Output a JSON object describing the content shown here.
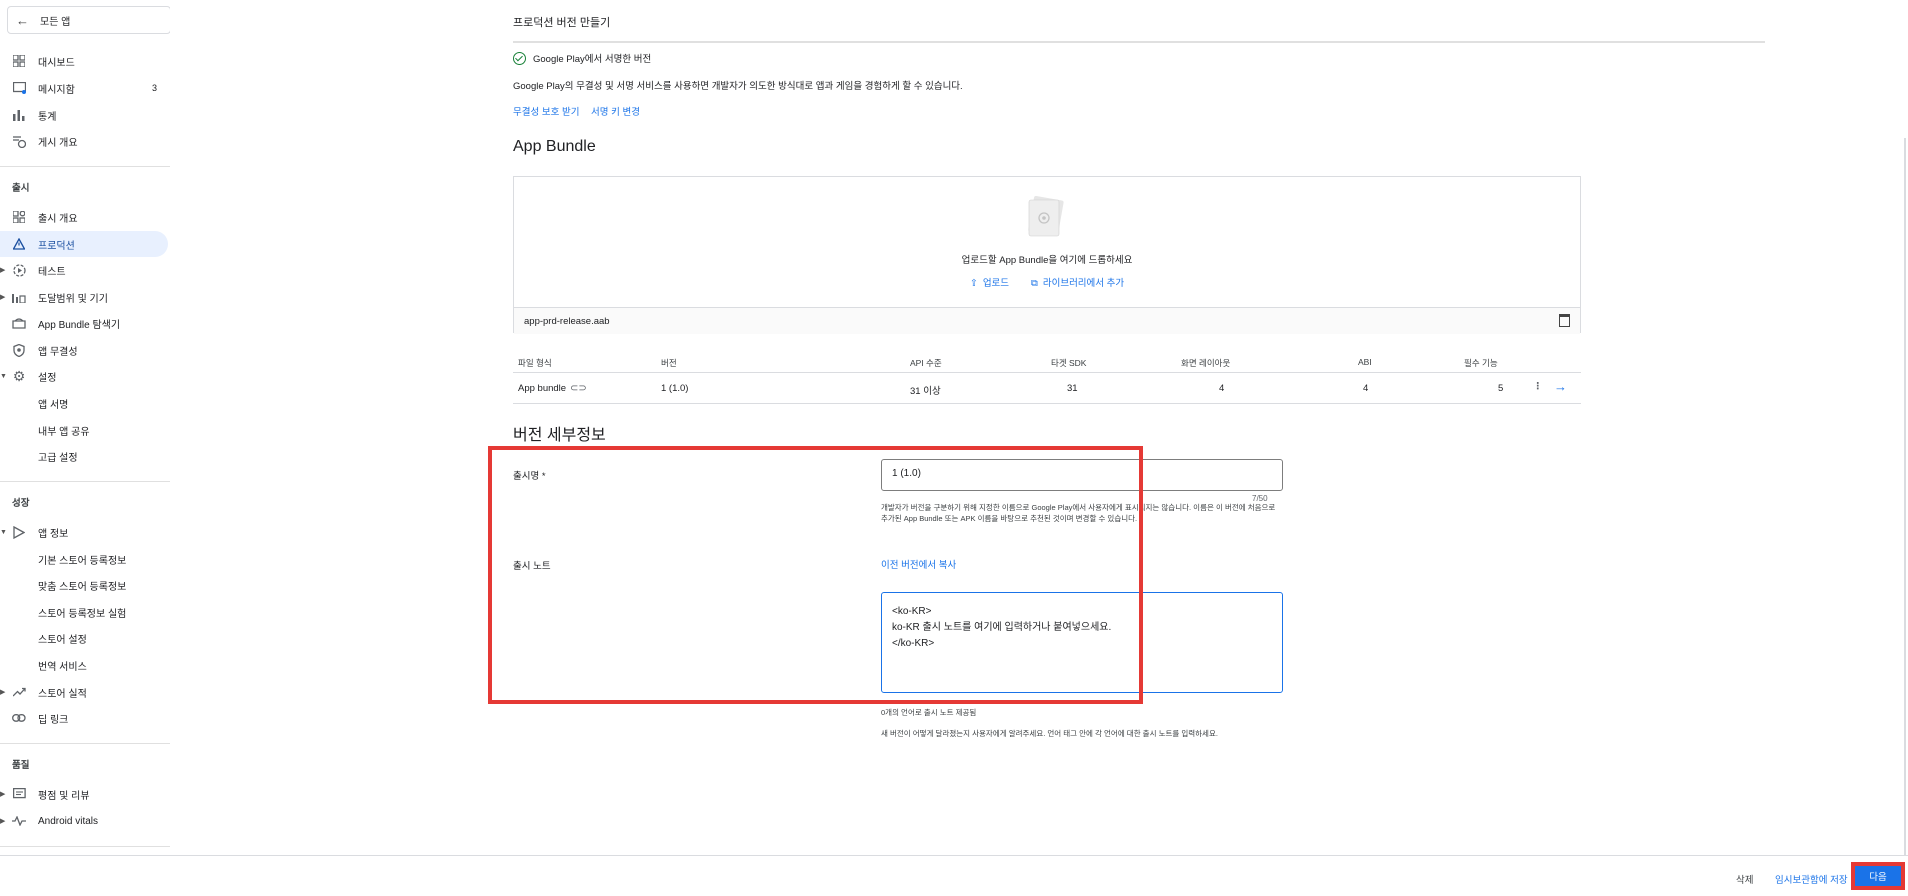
{
  "sidebar": {
    "all_apps": "모든 앱",
    "top_items": [
      {
        "label": "대시보드"
      },
      {
        "label": "메시지함",
        "count": "3"
      },
      {
        "label": "통계"
      },
      {
        "label": "게시 개요"
      }
    ],
    "release_title": "출시",
    "release_items": [
      {
        "label": "출시 개요"
      },
      {
        "label": "프로덕션"
      },
      {
        "label": "테스트"
      },
      {
        "label": "도달범위 및 기기"
      },
      {
        "label": "App Bundle 탐색기"
      },
      {
        "label": "앱 무결성"
      },
      {
        "label": "설정"
      },
      {
        "label": "앱 서명"
      },
      {
        "label": "내부 앱 공유"
      },
      {
        "label": "고급 설정"
      }
    ],
    "growth_title": "성장",
    "growth_items": [
      {
        "label": "앱 정보"
      },
      {
        "label": "기본 스토어 등록정보"
      },
      {
        "label": "맞춤 스토어 등록정보"
      },
      {
        "label": "스토어 등록정보 실험"
      },
      {
        "label": "스토어 설정"
      },
      {
        "label": "번역 서비스"
      },
      {
        "label": "스토어 실적"
      },
      {
        "label": "딥 링크"
      }
    ],
    "quality_title": "품질",
    "quality_items": [
      {
        "label": "평점 및 리뷰"
      },
      {
        "label": "Android vitals"
      }
    ]
  },
  "main": {
    "page_title": "프로덕션 버전 만들기",
    "signed_label": "Google Play에서 서명한 버전",
    "signed_desc": "Google Play의 무결성 및 서명 서비스를 사용하면 개발자가 의도한 방식대로 앱과 게임을 경험하게 할 수 있습니다.",
    "link_integrity": "무결성 보호 받기",
    "link_signing_key": "서명 키 변경",
    "bundle_title": "App Bundle",
    "bundle_drop_text": "업로드할 App Bundle을 여기에 드롭하세요",
    "upload_label": "업로드",
    "library_label": "라이브러리에서 추가",
    "file_name": "app-prd-release.aab",
    "table_headers": [
      "파일 형식",
      "버전",
      "API 수준",
      "타겟 SDK",
      "화면 레이아웃",
      "ABI",
      "필수 기능"
    ],
    "table_row": [
      "App bundle",
      "1 (1.0)",
      "31 이상",
      "31",
      "4",
      "4",
      "5"
    ],
    "details_title": "버전 세부정보",
    "release_name_label": "출시명",
    "release_name_required": "*",
    "release_name_value": "1 (1.0)",
    "release_name_counter": "7/50",
    "release_name_helper": "개발자가 버전을 구분하기 위해 지정한 이름으로 Google Play에서 사용자에게 표시되지는 않습니다. 이름은 이 버전에 처음으로 추가된 App Bundle 또는 APK 이름을 바탕으로 추천된 것이며 변경할 수 있습니다.",
    "release_notes_label": "출시 노트",
    "copy_previous_label": "이전 버전에서 복사",
    "release_notes_value": "<ko-KR>\nko-KR 출시 노트를 여기에 입력하거나 붙여넣으세요.\n</ko-KR>",
    "notes_count_text": "0개의 언어로 출시 노트 제공됨",
    "notes_help_text": "새 버전이 어떻게 달라졌는지 사용자에게 알려주세요. 언어 태그 안에 각 언어에 대한 출시 노트를 입력하세요."
  },
  "footer": {
    "delete_label": "삭제",
    "save_draft_label": "임시보관함에 저장",
    "next_label": "다음"
  },
  "colors": {
    "accent": "#1a73e8",
    "highlight": "#e53935",
    "active_nav_bg": "#e8f0fe"
  }
}
